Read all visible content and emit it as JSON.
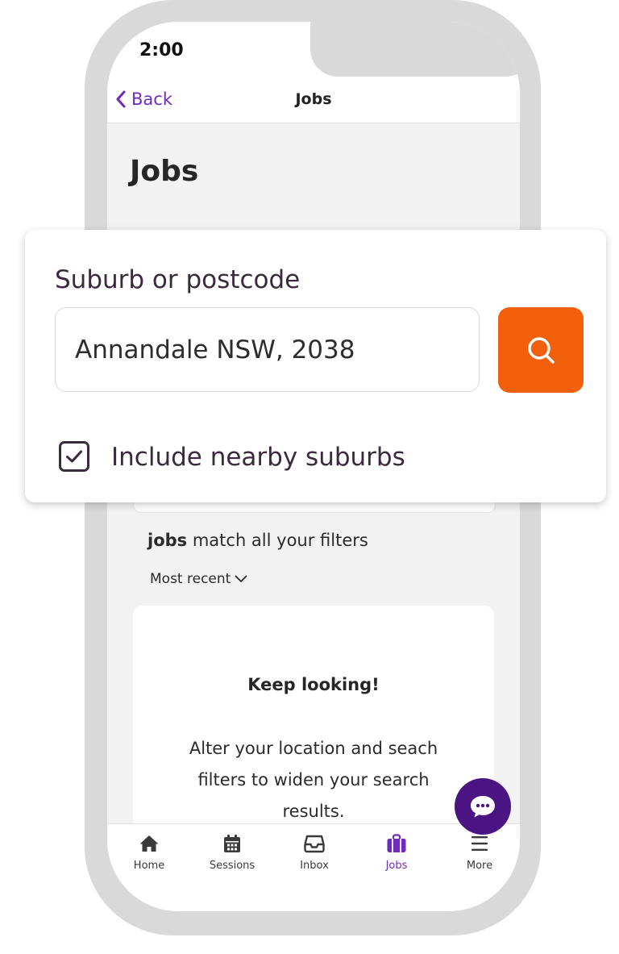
{
  "status_bar": {
    "time": "2:00"
  },
  "nav": {
    "back_label": "Back",
    "title": "Jobs"
  },
  "page": {
    "title": "Jobs"
  },
  "search": {
    "label": "Suburb or postcode",
    "value": "Annandale NSW, 2038",
    "search_icon": "search-icon",
    "nearby_label": "Include nearby suburbs",
    "nearby_checked": true
  },
  "results": {
    "match_bold": "jobs",
    "match_rest": " match all your filters",
    "sort_label": "Most recent"
  },
  "empty_state": {
    "title": "Keep looking!",
    "body": "Alter your location and seach filters to widen your search results."
  },
  "tabs": [
    {
      "label": "Home",
      "icon": "home-icon",
      "active": false
    },
    {
      "label": "Sessions",
      "icon": "calendar-icon",
      "active": false
    },
    {
      "label": "Inbox",
      "icon": "inbox-icon",
      "active": false
    },
    {
      "label": "Jobs",
      "icon": "briefcase-icon",
      "active": true
    },
    {
      "label": "More",
      "icon": "menu-icon",
      "active": false
    }
  ],
  "colors": {
    "accent_purple": "#6e2bbd",
    "chat_purple": "#4b1483",
    "search_orange": "#f2600c",
    "label_text": "#3b2a3d"
  }
}
